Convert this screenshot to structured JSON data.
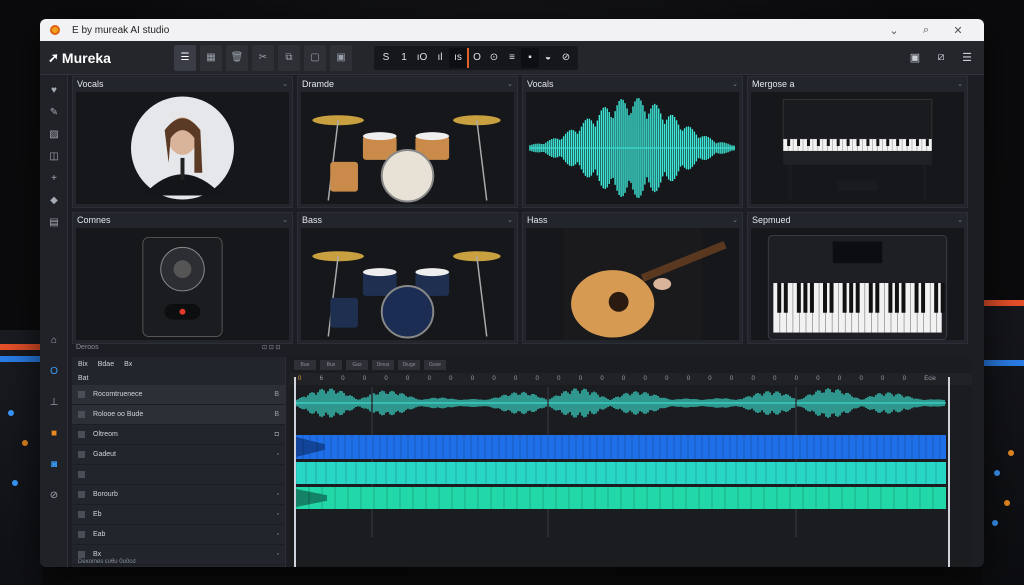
{
  "window": {
    "title": "E by mureak AI studio"
  },
  "titlebar_controls": [
    "⌄",
    "⌕",
    "✕"
  ],
  "brand": {
    "name": "Mureka"
  },
  "toolbar": {
    "buttons": [
      {
        "icon": "menu-icon",
        "glyph": "☰"
      },
      {
        "icon": "grid-icon",
        "glyph": "▦"
      },
      {
        "icon": "trash-icon",
        "glyph": "🗑"
      },
      {
        "icon": "scissors-icon",
        "glyph": "✂"
      },
      {
        "icon": "copy-icon",
        "glyph": "⧉"
      },
      {
        "icon": "paste-icon",
        "glyph": "▢"
      },
      {
        "icon": "layers-icon",
        "glyph": "▣"
      }
    ],
    "transport": [
      {
        "glyph": "S",
        "dark": false
      },
      {
        "glyph": "1",
        "dark": false
      },
      {
        "glyph": "ıO",
        "dark": false
      },
      {
        "glyph": "ıl",
        "dark": false
      },
      {
        "glyph": "ıs",
        "dark": true
      },
      {
        "glyph": "O",
        "dark": false,
        "marker": true
      },
      {
        "glyph": "⊙",
        "dark": false
      },
      {
        "glyph": "≡",
        "dark": false
      },
      {
        "glyph": "▪",
        "dark": true
      },
      {
        "glyph": "◒",
        "dark": false
      },
      {
        "glyph": "⊘",
        "dark": false
      }
    ],
    "right_icons": [
      "▣",
      "⧄",
      "☰"
    ]
  },
  "rail_icons": [
    {
      "name": "heart-icon",
      "glyph": "♥"
    },
    {
      "name": "pen-icon",
      "glyph": "✎"
    },
    {
      "name": "image-icon",
      "glyph": "▨"
    },
    {
      "name": "chat-icon",
      "glyph": "◫"
    },
    {
      "name": "plus-icon",
      "glyph": "+"
    },
    {
      "name": "pin-icon",
      "glyph": "◆"
    },
    {
      "name": "book-icon",
      "glyph": "▤"
    }
  ],
  "rail_icons_lower": [
    {
      "name": "home-icon",
      "glyph": "⌂",
      "style": ""
    },
    {
      "name": "circle-icon",
      "glyph": "O",
      "style": "accent"
    },
    {
      "name": "mixer-icon",
      "glyph": "⊥",
      "style": ""
    },
    {
      "name": "record-icon",
      "glyph": "■",
      "style": "warn"
    },
    {
      "name": "profile-icon",
      "glyph": "◙",
      "style": "accent"
    },
    {
      "name": "attach-icon",
      "glyph": "⊘",
      "style": ""
    }
  ],
  "panels": [
    {
      "title": "Vocals",
      "kind": "portrait"
    },
    {
      "title": "Dramde",
      "kind": "drums"
    },
    {
      "title": "Vocals",
      "kind": "waveform"
    },
    {
      "title": "Mergose a",
      "kind": "piano"
    },
    {
      "title": "Comnes",
      "kind": "speaker"
    },
    {
      "title": "Bass",
      "kind": "drums2"
    },
    {
      "title": "Hass",
      "kind": "guitar"
    },
    {
      "title": "Sepmued",
      "kind": "keyboard"
    }
  ],
  "panel_footer_left": "Deroos",
  "panel_footer_right": "⊡ ⊡ ⊡",
  "track_list": {
    "header_items": [
      "Bix",
      "Bdae",
      "Bx"
    ],
    "sub_header": "Bat",
    "rows": [
      {
        "name": "Rocomtruenece",
        "icon": "B",
        "selected": true
      },
      {
        "name": "Rolooe oo Bude",
        "icon": "B",
        "selected": true
      },
      {
        "name": "Oltreom",
        "icon": "◘",
        "selected": false
      },
      {
        "name": "Gadeut",
        "icon": "◦",
        "selected": false
      },
      {
        "name": "",
        "icon": "",
        "selected": false
      },
      {
        "name": "Borourb",
        "icon": "◦",
        "selected": false
      },
      {
        "name": "Eb",
        "icon": "◦",
        "selected": false
      },
      {
        "name": "Eab",
        "icon": "◦",
        "selected": false
      },
      {
        "name": "Bx",
        "icon": "◦",
        "selected": false
      }
    ],
    "footer": "Dexomes   ευθυ 0υ0ϲσ"
  },
  "timeline": {
    "tabs": [
      "Bue",
      "Bux",
      "Gas",
      "Dinux",
      "Diuge",
      "Goxe"
    ],
    "ruler_marks": [
      "0",
      "6",
      "0",
      "0",
      "0",
      "0",
      "0",
      "0",
      "0",
      "0",
      "0",
      "0",
      "0",
      "0",
      "0",
      "0",
      "0",
      "0",
      "0",
      "0",
      "0",
      "0",
      "0",
      "0",
      "0",
      "0",
      "0",
      "0",
      "0"
    ],
    "ruler_end": "Ecie"
  },
  "colors": {
    "wave_cyan": "#3ee8d8",
    "lane_blue": "#1f6fe8",
    "lane_teal": "#27d6c6",
    "lane_green": "#22d8a8",
    "accent_orange": "#e2602a"
  }
}
